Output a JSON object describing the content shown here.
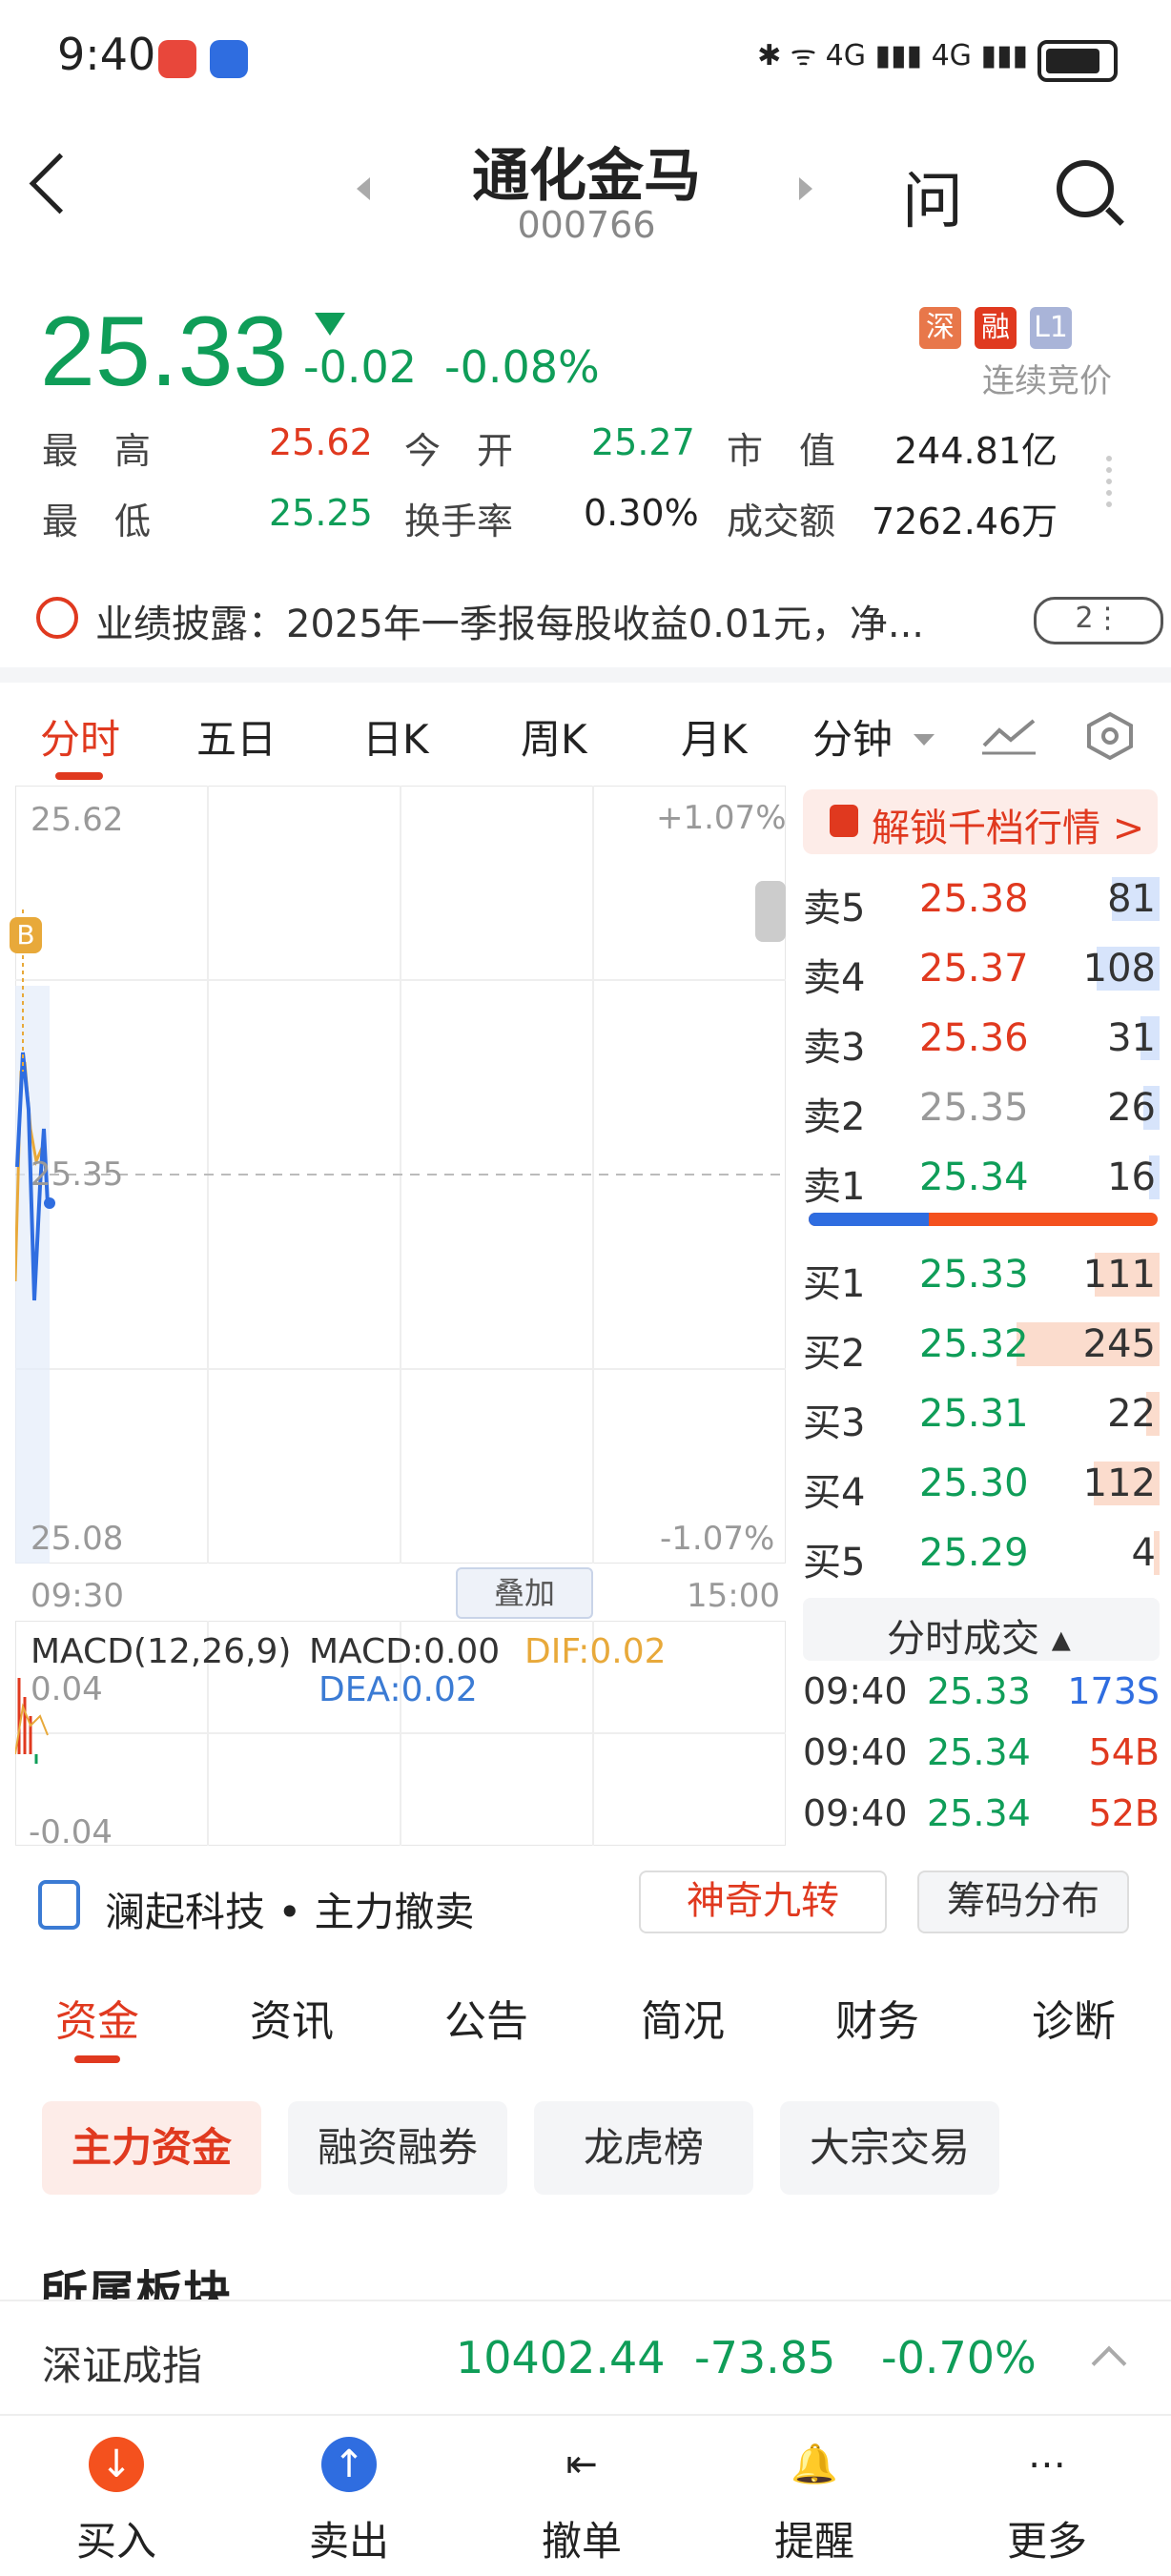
{
  "status_bar": {
    "time": "9:40",
    "icons": "✱ ᯤ 4G ▮▮▮ 4G ▮▮▮"
  },
  "header": {
    "title": "通化金马",
    "code": "000766",
    "ask_label": "问"
  },
  "quote": {
    "price": "25.33",
    "change": "-0.02",
    "change_pct": "-0.08%",
    "badges": [
      {
        "text": "深",
        "color": "#e8774a"
      },
      {
        "text": "融",
        "color": "#e0391f"
      },
      {
        "text": "L1",
        "color": "#a9b4d8"
      }
    ],
    "status": "连续竞价",
    "high_label": "最　高",
    "high": "25.62",
    "open_label": "今　开",
    "open": "25.27",
    "mcap_label": "市　值",
    "mcap": "244.81亿",
    "low_label": "最　低",
    "low": "25.25",
    "turnover_label": "换手率",
    "turnover": "0.30%",
    "amount_label": "成交额",
    "amount": "7262.46万"
  },
  "disclosure": {
    "label": "业绩披露：2025年一季报每股收益0.01元，净...",
    "count": "2⋮"
  },
  "chart_tabs": [
    "分时",
    "五日",
    "日K",
    "周K",
    "月K",
    "分钟"
  ],
  "chart": {
    "y_top": "25.62",
    "y_mid": "25.35",
    "y_bottom": "25.08",
    "pct_top": "+1.07%",
    "pct_bottom": "-1.07%",
    "t_start": "09:30",
    "t_end": "15:00",
    "overlay_label": "叠加",
    "b_marker": "B",
    "macd_title": "MACD(12,26,9)",
    "macd_val": "MACD:0.00",
    "dif": "DIF:0.02",
    "dea": "DEA:0.02",
    "macd_top": "0.04",
    "macd_bottom": "-0.04"
  },
  "orderbook": {
    "unlock_label": "解锁千档行情 >",
    "asks": [
      {
        "label": "卖5",
        "price": "25.38",
        "vol": "81",
        "depth": 0.33
      },
      {
        "label": "卖4",
        "price": "25.37",
        "vol": "108",
        "depth": 0.44
      },
      {
        "label": "卖3",
        "price": "25.36",
        "vol": "31",
        "depth": 0.13
      },
      {
        "label": "卖2",
        "price": "25.35",
        "vol": "26",
        "depth": 0.11
      },
      {
        "label": "卖1",
        "price": "25.34",
        "vol": "16",
        "depth": 0.07
      }
    ],
    "bids": [
      {
        "label": "买1",
        "price": "25.33",
        "vol": "111",
        "depth": 0.45
      },
      {
        "label": "买2",
        "price": "25.32",
        "vol": "245",
        "depth": 1.0
      },
      {
        "label": "买3",
        "price": "25.31",
        "vol": "22",
        "depth": 0.09
      },
      {
        "label": "买4",
        "price": "25.30",
        "vol": "112",
        "depth": 0.46
      },
      {
        "label": "买5",
        "price": "25.29",
        "vol": "4",
        "depth": 0.02
      }
    ],
    "ticks_label": "分时成交 ▴",
    "ticks": [
      {
        "time": "09:40",
        "price": "25.33",
        "vol": "173S"
      },
      {
        "time": "09:40",
        "price": "25.34",
        "vol": "54B"
      },
      {
        "time": "09:40",
        "price": "25.34",
        "vol": "52B"
      }
    ]
  },
  "feature_bar": {
    "lanqi": "澜起科技 • 主力撤卖",
    "magic_label": "神奇九转",
    "chips_label": "筹码分布"
  },
  "info_tabs": [
    "资金",
    "资讯",
    "公告",
    "简况",
    "财务",
    "诊断"
  ],
  "sub_tabs": [
    "主力资金",
    "融资融券",
    "龙虎榜",
    "大宗交易"
  ],
  "section_title": "所属板块",
  "index_bar": {
    "name": "深证成指",
    "value": "10402.44",
    "change": "-73.85",
    "pct": "-0.70%"
  },
  "bottom_nav": [
    "买入",
    "卖出",
    "撤单",
    "提醒",
    "更多"
  ],
  "colors": {
    "up": "#e0391f",
    "down": "#0f9d58",
    "accent": "#e0391f"
  }
}
